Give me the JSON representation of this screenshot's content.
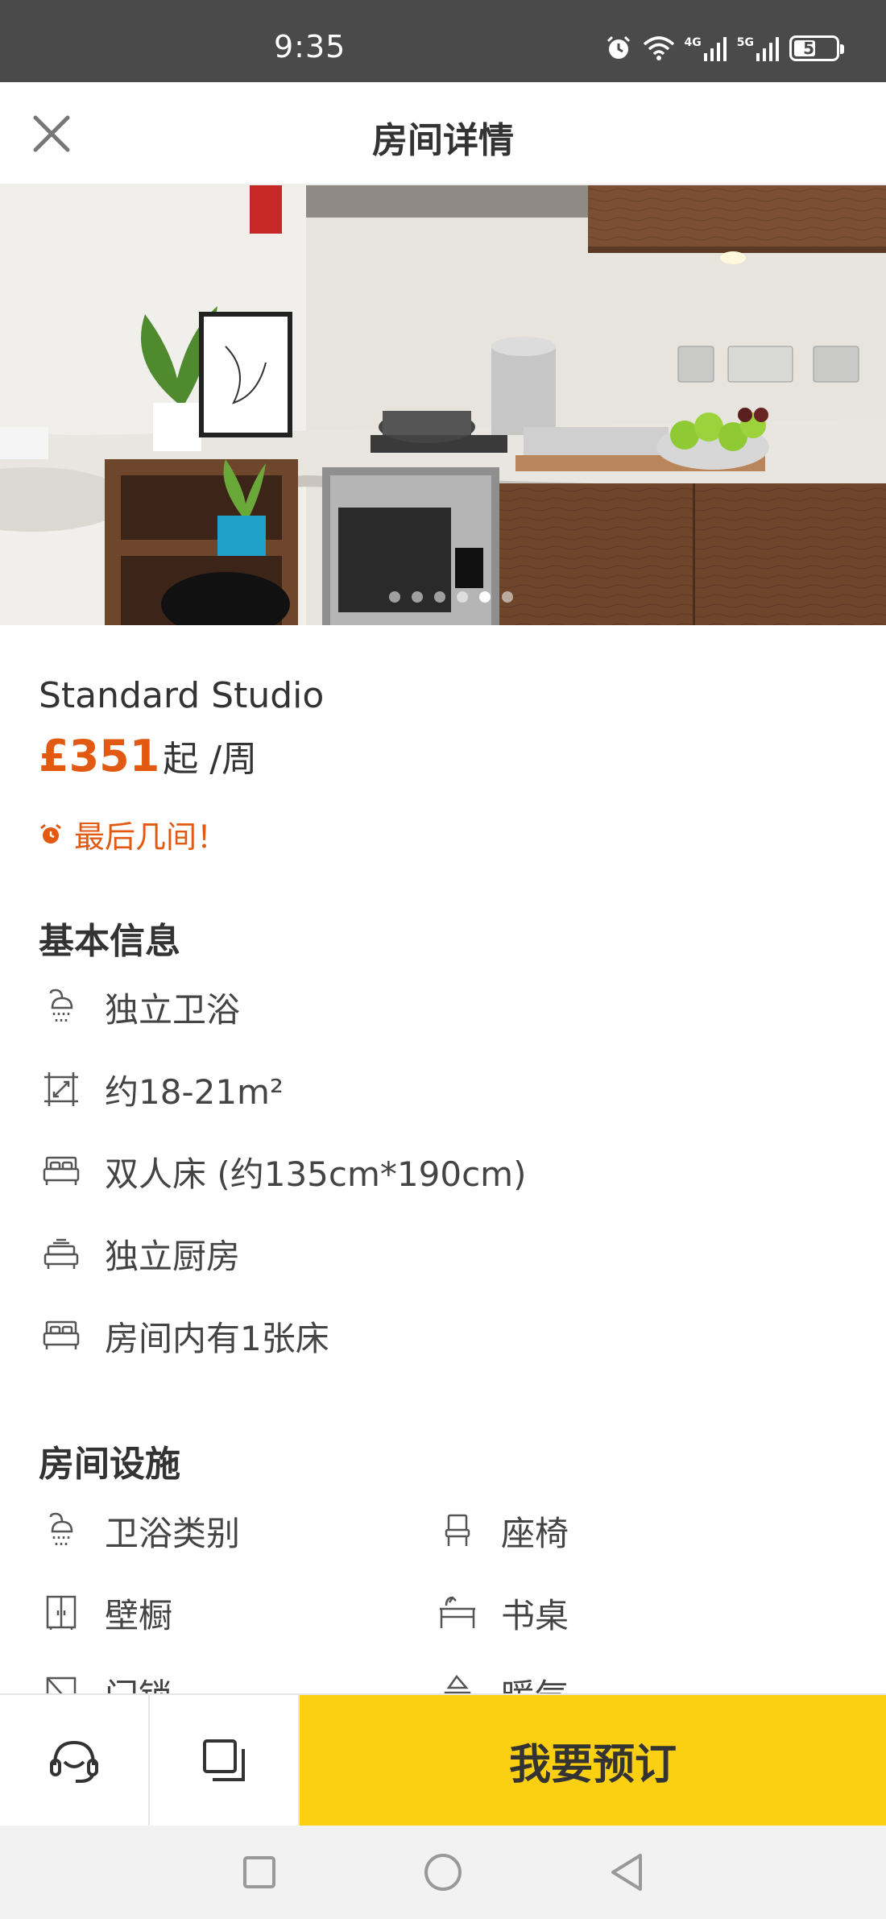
{
  "status_bar": {
    "time": "9:35",
    "network_a": "4G",
    "network_b": "5G",
    "battery": "51"
  },
  "header": {
    "title": "房间详情",
    "close_icon": "close-icon"
  },
  "carousel": {
    "slide_count": 6,
    "active_index": 4
  },
  "room": {
    "name": "Standard Studio",
    "price": "£351",
    "price_unit": "起 /周",
    "alert": "最后几间！"
  },
  "basic_info": {
    "title": "基本信息",
    "items": [
      {
        "icon": "shower-icon",
        "label": "独立卫浴"
      },
      {
        "icon": "area-icon",
        "label": "约18-21m²"
      },
      {
        "icon": "bed-icon",
        "label": "双人床 (约135cm*190cm)"
      },
      {
        "icon": "stove-icon",
        "label": "独立厨房"
      },
      {
        "icon": "bed-icon",
        "label": "房间内有1张床"
      }
    ]
  },
  "facilities": {
    "title": "房间设施",
    "items": [
      {
        "icon": "shower-icon",
        "label": "卫浴类别"
      },
      {
        "icon": "chair-icon",
        "label": "座椅"
      },
      {
        "icon": "wardrobe-icon",
        "label": "壁橱"
      },
      {
        "icon": "desk-icon",
        "label": "书桌"
      },
      {
        "icon": "window-icon",
        "label": "门锁"
      },
      {
        "icon": "heater-icon",
        "label": "暖气"
      }
    ]
  },
  "bottom_bar": {
    "support_icon": "headset-icon",
    "compare_icon": "copy-icon",
    "book_label": "我要预订"
  },
  "colors": {
    "accent": "#e25a12",
    "book_button": "#fcd012",
    "status_bar": "#4a4a4a"
  }
}
